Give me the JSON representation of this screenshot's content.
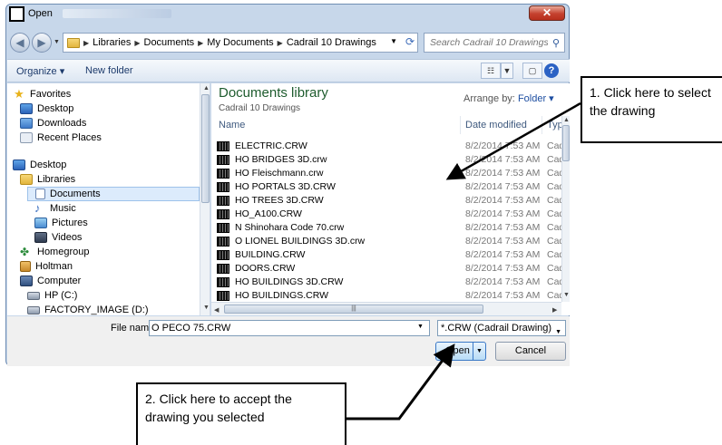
{
  "window": {
    "title": "Open",
    "close_glyph": "✕"
  },
  "address_bar": {
    "crumbs": [
      "Libraries",
      "Documents",
      "My Documents",
      "Cadrail 10 Drawings"
    ]
  },
  "search": {
    "placeholder": "Search Cadrail 10 Drawings"
  },
  "toolbar": {
    "organize_label": "Organize ▾",
    "new_folder_label": "New folder",
    "help_label": "?"
  },
  "nav_pane": {
    "items": [
      {
        "label": "Favorites",
        "icon": "star-icon"
      },
      {
        "label": "Desktop",
        "icon": "desktop-icon"
      },
      {
        "label": "Downloads",
        "icon": "downloads-icon"
      },
      {
        "label": "Recent Places",
        "icon": "recent-places-icon"
      },
      {
        "label": "Desktop",
        "icon": "desktop-icon"
      },
      {
        "label": "Libraries",
        "icon": "libraries-icon"
      },
      {
        "label": "Documents",
        "icon": "documents-icon"
      },
      {
        "label": "Music",
        "icon": "music-icon"
      },
      {
        "label": "Pictures",
        "icon": "pictures-icon"
      },
      {
        "label": "Videos",
        "icon": "videos-icon"
      },
      {
        "label": "Homegroup",
        "icon": "homegroup-icon"
      },
      {
        "label": "Holtman",
        "icon": "user-folder-icon"
      },
      {
        "label": "Computer",
        "icon": "computer-icon"
      },
      {
        "label": "HP (C:)",
        "icon": "drive-icon"
      },
      {
        "label": "FACTORY_IMAGE (D:)",
        "icon": "drive-icon"
      }
    ],
    "selected": "Documents"
  },
  "library": {
    "title": "Documents library",
    "subtitle": "Cadrail 10 Drawings",
    "arrange_label": "Arrange by:",
    "arrange_value": "Folder ▾"
  },
  "columns": {
    "name": "Name",
    "date": "Date modified",
    "type": "Type"
  },
  "files": [
    {
      "name": "ELECTRIC.CRW",
      "date": "8/2/2014 7:53 AM",
      "type": "Cadra"
    },
    {
      "name": "HO BRIDGES 3D.crw",
      "date": "8/2/2014 7:53 AM",
      "type": "Cadra"
    },
    {
      "name": "HO Fleischmann.crw",
      "date": "8/2/2014 7:53 AM",
      "type": "Cadra"
    },
    {
      "name": "HO PORTALS 3D.CRW",
      "date": "8/2/2014 7:53 AM",
      "type": "Cadra"
    },
    {
      "name": "HO TREES 3D.CRW",
      "date": "8/2/2014 7:53 AM",
      "type": "Cadra"
    },
    {
      "name": "HO_A100.CRW",
      "date": "8/2/2014 7:53 AM",
      "type": "Cadra"
    },
    {
      "name": "N Shinohara Code 70.crw",
      "date": "8/2/2014 7:53 AM",
      "type": "Cadra"
    },
    {
      "name": "O LIONEL BUILDINGS 3D.crw",
      "date": "8/2/2014 7:53 AM",
      "type": "Cadra"
    },
    {
      "name": "BUILDING.CRW",
      "date": "8/2/2014 7:53 AM",
      "type": "Cadra"
    },
    {
      "name": "DOORS.CRW",
      "date": "8/2/2014 7:53 AM",
      "type": "Cadra"
    },
    {
      "name": "HO BUILDINGS 3D.CRW",
      "date": "8/2/2014 7:53 AM",
      "type": "Cadra"
    },
    {
      "name": "HO BUILDINGS.CRW",
      "date": "8/2/2014 7:53 AM",
      "type": "Cadra"
    }
  ],
  "bottom": {
    "file_name_label": "File name:",
    "file_name_value": "O PECO 75.CRW",
    "filter_value": "*.CRW (Cadrail Drawing)",
    "open_label": "Open",
    "cancel_label": "Cancel"
  },
  "callouts": {
    "one": "1. Click here to select the drawing",
    "two": "2. Click here to accept the drawing you selected"
  }
}
